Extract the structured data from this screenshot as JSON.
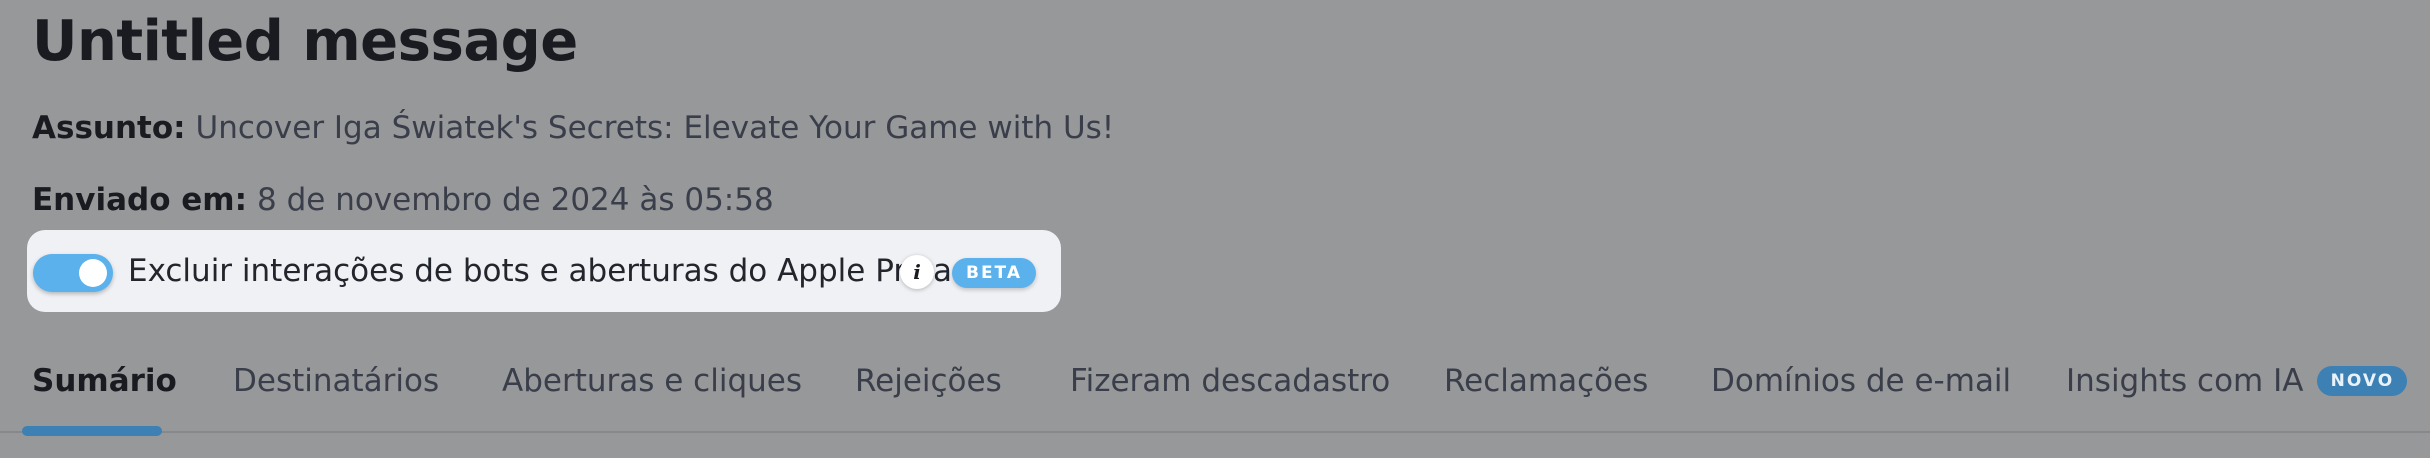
{
  "message": {
    "title": "Untitled message",
    "subject_key": "Assunto:",
    "subject_value": "Uncover Iga Światek's Secrets: Elevate Your Game with Us!",
    "sent_key": "Enviado em:",
    "sent_value": "8 de novembro de 2024 às 05:58"
  },
  "filter": {
    "label": "Excluir interações de bots e aberturas do Apple Privacy",
    "enabled": true,
    "info_icon": "info-icon",
    "badge": "BETA"
  },
  "tabs": [
    {
      "label": "Sumário",
      "active": true
    },
    {
      "label": "Destinatários"
    },
    {
      "label": "Aberturas e cliques"
    },
    {
      "label": "Rejeições"
    },
    {
      "label": "Fizeram descadastro"
    },
    {
      "label": "Reclamações"
    },
    {
      "label": "Domínios de e-mail"
    },
    {
      "label": "Insights com IA",
      "badge": "NOVO"
    }
  ],
  "colors": {
    "accent": "#5ab1ec",
    "tab_active": "#3c80b4",
    "overlay_background": "#97989a"
  }
}
